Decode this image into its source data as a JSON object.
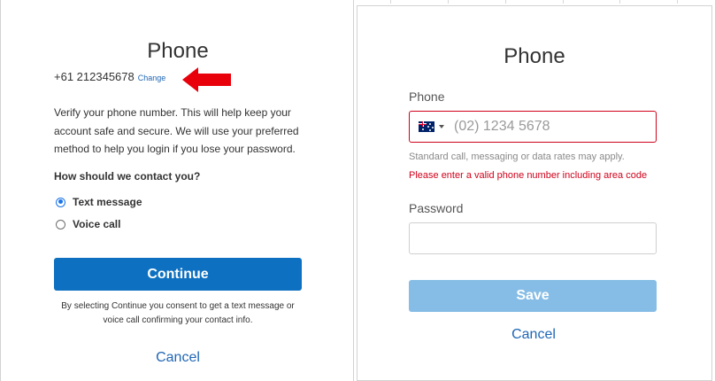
{
  "left_dialog": {
    "title": "Phone",
    "phone_number": "+61 212345678",
    "change_label": "Change",
    "description": "Verify your phone number. This will help keep your account safe and secure. We will use your preferred method to help you login if you lose your password.",
    "contact_question": "How should we contact you?",
    "options": [
      {
        "label": "Text message",
        "selected": true
      },
      {
        "label": "Voice call",
        "selected": false
      }
    ],
    "continue_label": "Continue",
    "consent_text": "By selecting Continue you consent to get a text message or voice call confirming your contact info.",
    "cancel_label": "Cancel",
    "annotation_color": "#e8000b"
  },
  "right_dialog": {
    "title": "Phone",
    "phone_label": "Phone",
    "country_flag": "australia-flag-icon",
    "phone_placeholder": "(02) 1234 5678",
    "phone_value": "",
    "rates_note": "Standard call, messaging or data rates may apply.",
    "error_message": "Please enter a valid phone number including area code",
    "password_label": "Password",
    "password_value": "",
    "save_label": "Save",
    "cancel_label": "Cancel"
  },
  "colors": {
    "primary_button": "#0e70c0",
    "disabled_button": "#86bde6",
    "link": "#1f66b5",
    "error": "#d0021b"
  }
}
